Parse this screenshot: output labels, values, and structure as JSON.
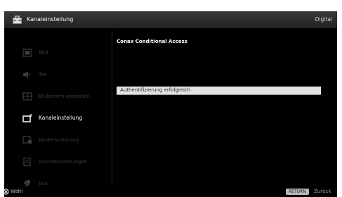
{
  "header": {
    "icon": "toolbox-icon",
    "title": "Kanaleinstellung",
    "mode": "Digital"
  },
  "sidebar": {
    "items": [
      {
        "label": "Bild",
        "icon": "picture-icon",
        "active": false
      },
      {
        "label": "Ton",
        "icon": "speaker-icon",
        "active": false
      },
      {
        "label": "Bildschirm einstellen",
        "icon": "screen-adjust-icon",
        "active": false
      },
      {
        "label": "Kanaleinstellung",
        "icon": "channel-setup-icon",
        "active": true
      },
      {
        "label": "Kindersicherung",
        "icon": "parental-lock-icon",
        "active": false
      },
      {
        "label": "Grundeinstellungen",
        "icon": "settings-list-icon",
        "active": false
      },
      {
        "label": "Eco",
        "icon": "eco-leaf-icon",
        "active": false
      }
    ]
  },
  "panel": {
    "title": "Conax Conditional Access",
    "selected_item": "Authentifizierung erfolgreich"
  },
  "footer": {
    "nav_icon": "navigation-pad-icon",
    "nav_label": "Wahl",
    "return_key": "RETURN",
    "return_label": "Zurück"
  },
  "colors": {
    "screen_background": "#000000",
    "highlight": "#e3e3e3",
    "inactive_text": "#3d3d3d",
    "active_text": "#ffffff"
  }
}
